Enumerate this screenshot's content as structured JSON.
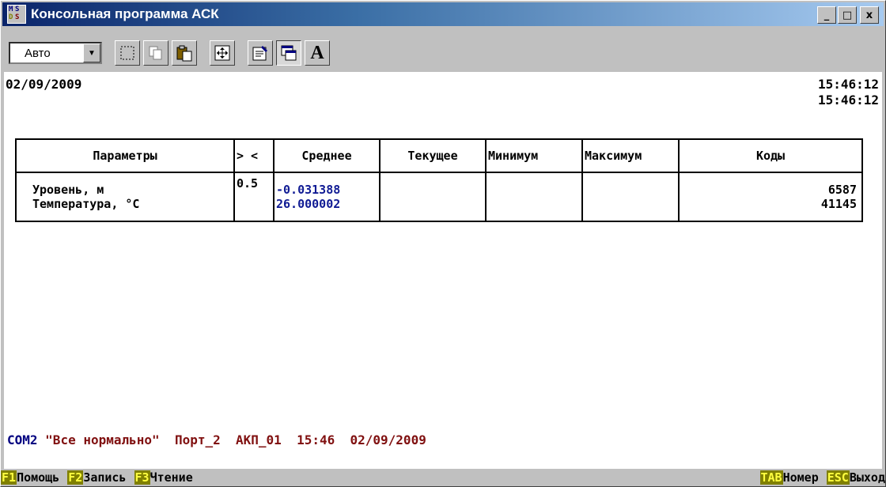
{
  "window": {
    "title": "Консольная программа АСК",
    "controls": [
      "_",
      "□",
      "x"
    ]
  },
  "toolbar": {
    "font_select": "Авто",
    "buttons": [
      "mark-icon",
      "copy-icon",
      "paste-icon",
      "fullscreen-icon",
      "properties-icon",
      "background-icon",
      "font-icon"
    ],
    "font_button_label": "A"
  },
  "console": {
    "date": "02/09/2009",
    "time_1": "15:46:12",
    "time_2": "15:46:12",
    "table": {
      "headers": [
        "Параметры",
        "> <",
        "Среднее",
        "Текущее",
        "Минимум",
        "Максимум",
        "Коды"
      ],
      "rows": [
        {
          "params": [
            "Уровень, м",
            "Температура, °С"
          ],
          "threshold": "0.5",
          "avg": [
            "-0.031388",
            "26.000002"
          ],
          "current": "",
          "min": "",
          "max": "",
          "codes": [
            "6587",
            "41145"
          ]
        }
      ]
    },
    "status": {
      "port": "COM2",
      "message": "\"Все нормально\"",
      "port_name": "Порт_2",
      "device": "АКП_01",
      "time": "15:46",
      "date": "02/09/2009"
    }
  },
  "function_keys": [
    {
      "key": "F1",
      "label": "Помощь"
    },
    {
      "key": "F2",
      "label": "Запись"
    },
    {
      "key": "F3",
      "label": "Чтение"
    },
    {
      "key": "TAB",
      "label": "Номер"
    },
    {
      "key": "ESC",
      "label": "Выход"
    }
  ],
  "colors": {
    "title_bar": "#0a246a",
    "value_text": "#101b94",
    "status_text": "#801010",
    "fkey_bg": "#808000",
    "fkey_text": "#ffff40"
  }
}
